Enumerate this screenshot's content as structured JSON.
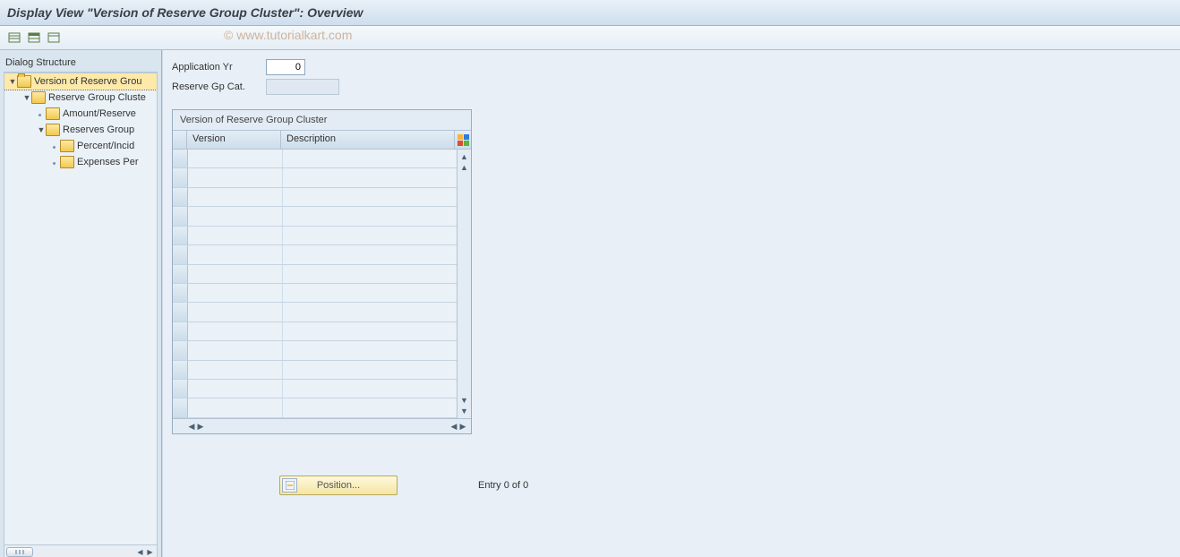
{
  "title": "Display View \"Version of Reserve Group Cluster\": Overview",
  "copyright": "© www.tutorialkart.com",
  "toolbar": {
    "btn1": "expand-all",
    "btn2": "collapse-all",
    "btn3": "select-all"
  },
  "tree": {
    "heading": "Dialog Structure",
    "items": [
      {
        "label": "Version of Reserve Grou",
        "level": 1,
        "selected": true,
        "open": true,
        "expandable": true
      },
      {
        "label": "Reserve Group Cluste",
        "level": 2,
        "selected": false,
        "open": false,
        "expandable": true
      },
      {
        "label": "Amount/Reserve",
        "level": 3,
        "selected": false,
        "open": false,
        "expandable": false
      },
      {
        "label": "Reserves Group",
        "level": 3,
        "selected": false,
        "open": false,
        "expandable": true
      },
      {
        "label": "Percent/Incid",
        "level": 4,
        "selected": false,
        "open": false,
        "expandable": false
      },
      {
        "label": "Expenses Per",
        "level": 4,
        "selected": false,
        "open": false,
        "expandable": false
      }
    ]
  },
  "form": {
    "app_yr_label": "Application Yr",
    "app_yr_value": "0",
    "reserve_cat_label": "Reserve Gp Cat.",
    "reserve_cat_value": ""
  },
  "table": {
    "title": "Version of Reserve Group Cluster",
    "columns": {
      "version": "Version",
      "description": "Description"
    },
    "row_count": 14,
    "rows": []
  },
  "footer": {
    "position_label": "Position...",
    "entry_text": "Entry 0 of 0"
  }
}
